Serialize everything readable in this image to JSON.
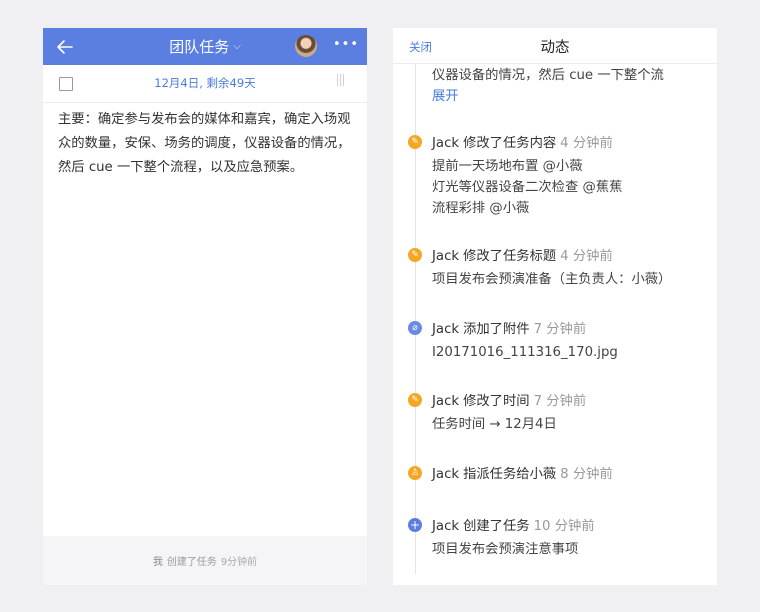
{
  "task_panel": {
    "header_title": "团队任务",
    "date_info": "12月4日, 剩余49天",
    "description": "主要：确定参与发布会的媒体和嘉宾，确定入场观众的数量，安保、场务的调度，仪器设备的情况，然后 cue 一下整个流程，以及应急预案。",
    "footer": {
      "actor": "我",
      "action": "创建了任务",
      "time": "9分钟前"
    }
  },
  "activity_panel": {
    "close_label": "关闭",
    "title": "动态",
    "truncated_text": "仪器设备的情况，然后 cue 一下整个流",
    "expand_label": "展开",
    "entries": [
      {
        "icon": "pencil-icon",
        "actor": "Jack",
        "action": "修改了任务内容",
        "time": "4 分钟前",
        "details": [
          "提前一天场地布置 @小薇",
          "灯光等仪器设备二次检查 @蕉蕉",
          "流程彩排 @小薇"
        ]
      },
      {
        "icon": "pencil-icon",
        "actor": "Jack",
        "action": "修改了任务标题",
        "time": "4 分钟前",
        "details": [
          "项目发布会预演准备（主负责人：小薇）"
        ]
      },
      {
        "icon": "paperclip-icon",
        "actor": "Jack",
        "action": "添加了附件",
        "time": "7 分钟前",
        "details": [
          "I20171016_111316_170.jpg"
        ]
      },
      {
        "icon": "pencil-icon",
        "actor": "Jack",
        "action": "修改了时间",
        "time": "7 分钟前",
        "details": [
          "任务时间  → 12月4日"
        ]
      },
      {
        "icon": "person-icon",
        "actor": "Jack",
        "action": "指派任务给小薇",
        "time": "8 分钟前",
        "details": []
      },
      {
        "icon": "plus-icon",
        "actor": "Jack",
        "action": "创建了任务",
        "time": "10 分钟前",
        "details": [
          "项目发布会预演注意事项"
        ]
      }
    ]
  },
  "colors": {
    "accent": "#5b7fe0",
    "link": "#4a7ae0",
    "edit_icon": "#f5a623"
  }
}
